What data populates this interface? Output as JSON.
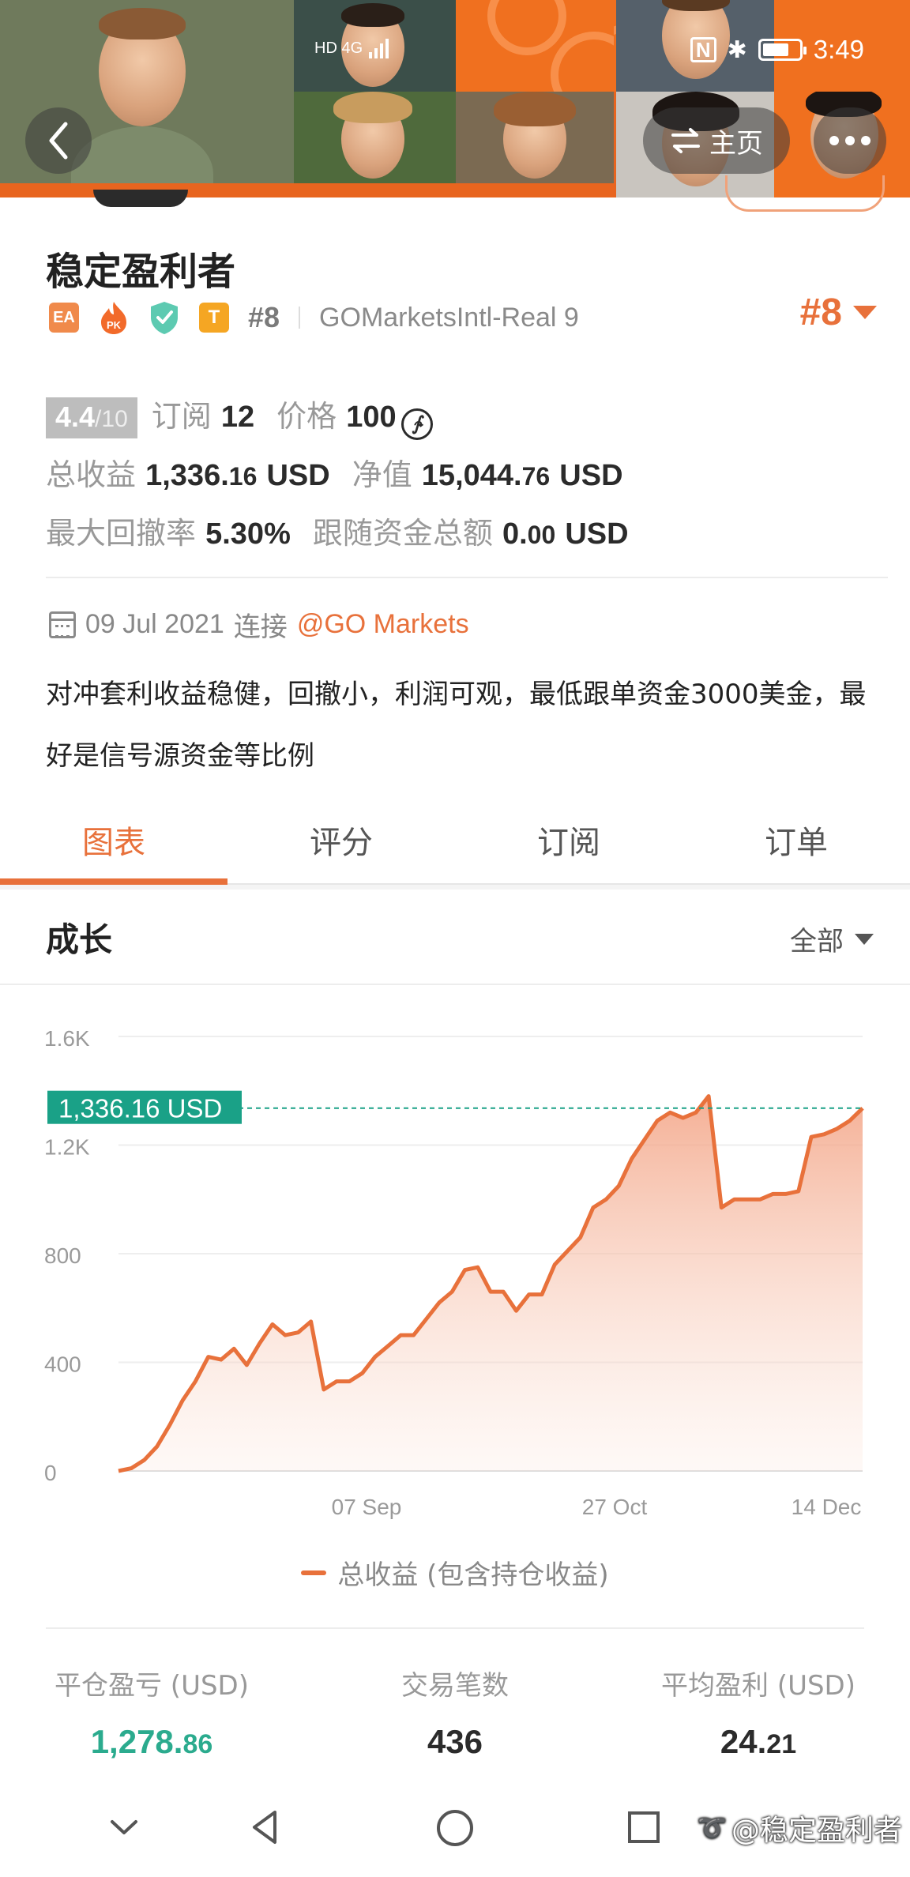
{
  "status_bar": {
    "time": "3:49",
    "network_left": "HD 4G"
  },
  "header": {
    "home_label": "主页"
  },
  "profile": {
    "name": "稳定盈利者",
    "badges": {
      "ea": "EA",
      "pk": "PK",
      "t": "T"
    },
    "rank_small": "#8",
    "broker_account": "GOMarketsIntl-Real 9",
    "rank_big": "#8"
  },
  "metrics": {
    "score": "4.4",
    "score_max": "/10",
    "subscribe_label": "订阅",
    "subscribe_count": "12",
    "price_label": "价格",
    "price_value": "100",
    "price_symbol": "∱",
    "profit_label": "总收益",
    "profit_int": "1,336.",
    "profit_dec": "16",
    "profit_unit": "USD",
    "equity_label": "净值",
    "equity_int": "15,044.",
    "equity_dec": "76",
    "equity_unit": "USD",
    "drawdown_label": "最大回撤率",
    "drawdown_value": "5.30%",
    "follow_funds_label": "跟随资金总额",
    "follow_funds_int": "0.",
    "follow_funds_dec": "00",
    "follow_funds_unit": "USD"
  },
  "join": {
    "date": "09 Jul 2021",
    "connect_label": "连接",
    "broker_link": "@GO Markets"
  },
  "description": "对冲套利收益稳健，回撤小，利润可观，最低跟单资金3000美金，最好是信号源资金等比例",
  "tabs": [
    {
      "label": "图表",
      "active": true
    },
    {
      "label": "评分",
      "active": false
    },
    {
      "label": "订阅",
      "active": false
    },
    {
      "label": "订单",
      "active": false
    }
  ],
  "growth": {
    "title": "成长",
    "filter": "全部"
  },
  "chart_data": {
    "type": "area",
    "y_ticks": [
      "0",
      "400",
      "800",
      "1.2K",
      "1.6K"
    ],
    "ylim": [
      0,
      1600
    ],
    "x_ticks": [
      "07 Sep",
      "27 Oct",
      "14 Dec"
    ],
    "current_label": "1,336.16 USD",
    "current_value": 1336.16,
    "series": [
      {
        "name": "总收益 (包含持仓收益)",
        "values": [
          0,
          10,
          40,
          90,
          170,
          260,
          330,
          420,
          410,
          450,
          390,
          470,
          540,
          500,
          510,
          550,
          300,
          330,
          330,
          360,
          420,
          460,
          500,
          500,
          560,
          620,
          660,
          740,
          750,
          660,
          660,
          590,
          650,
          650,
          760,
          810,
          860,
          970,
          1000,
          1050,
          1150,
          1220,
          1290,
          1320,
          1300,
          1320,
          1380,
          970,
          1000,
          1000,
          1000,
          1020,
          1020,
          1030,
          1230,
          1240,
          1260,
          1290,
          1336
        ]
      }
    ],
    "color": "#e8713b",
    "label_color": "#1aa187"
  },
  "legend": {
    "label": "总收益 (包含持仓收益)"
  },
  "stats": [
    {
      "label": "平仓盈亏 (USD)",
      "int": "1,278.",
      "dec": "86",
      "color": "green"
    },
    {
      "label": "交易笔数",
      "int": "436",
      "dec": "",
      "color": "dark"
    },
    {
      "label": "平均盈利 (USD)",
      "int": "24.",
      "dec": "21",
      "color": "dark"
    }
  ],
  "watermark": "@稳定盈利者"
}
